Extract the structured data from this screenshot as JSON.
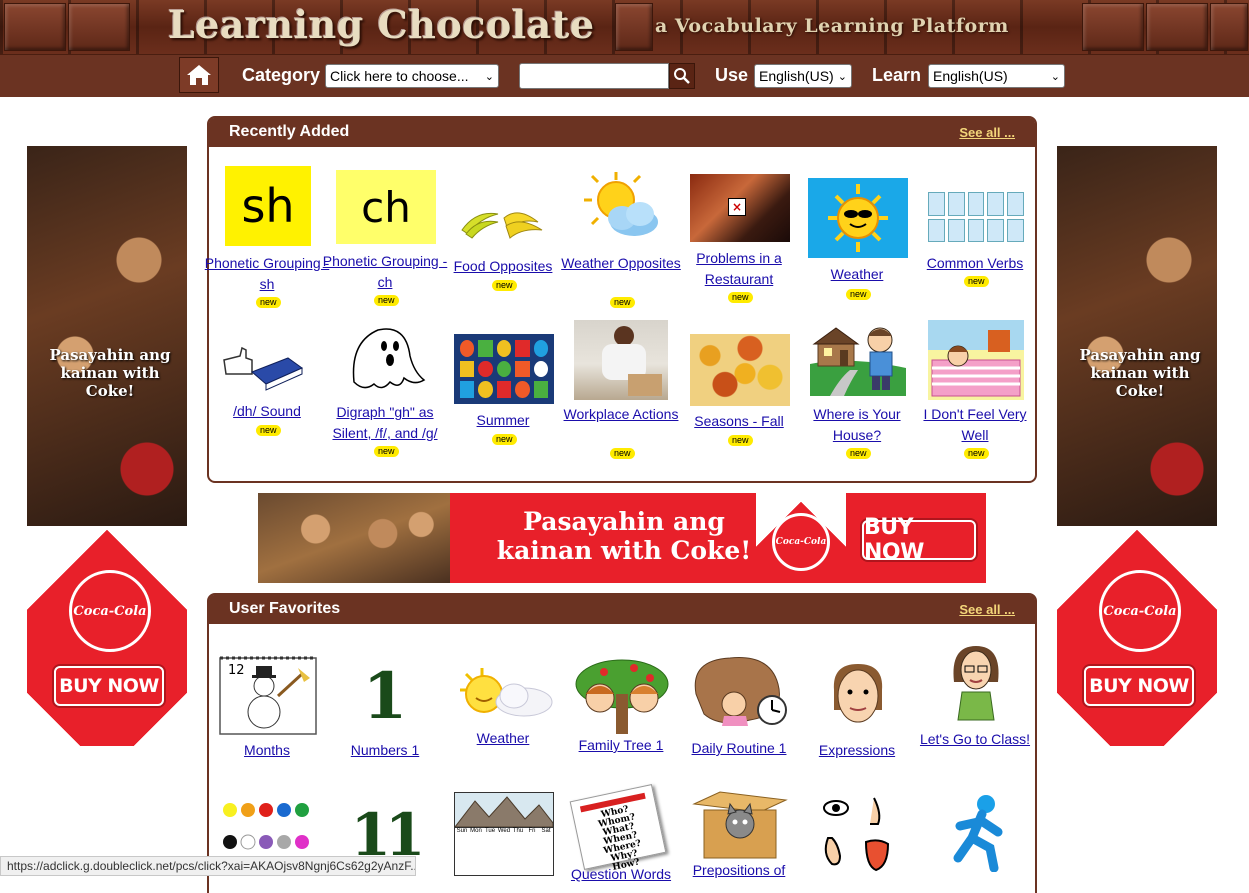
{
  "header": {
    "logo": "Learning Chocolate",
    "tagline": "a Vocabulary Learning Platform"
  },
  "nav": {
    "home_icon": "home-icon",
    "category_label": "Category",
    "category_value": "Click here to choose...",
    "search_value": "",
    "search_icon": "search-icon",
    "use_label": "Use",
    "use_value": "English(US)",
    "learn_label": "Learn",
    "learn_value": "English(US)"
  },
  "recent": {
    "title": "Recently Added",
    "see_all": "See all ...",
    "new_badge": "new",
    "items": [
      {
        "label": "Phonetic Grouping - sh",
        "icon": "sh-card"
      },
      {
        "label": "Phonetic Grouping - ch",
        "icon": "ch-card"
      },
      {
        "label": "Food Opposites",
        "icon": "bananas"
      },
      {
        "label": "Weather Opposites",
        "icon": "sun-cloud"
      },
      {
        "label": "Problems in a Restaurant",
        "icon": "restaurant-photo"
      },
      {
        "label": "Weather",
        "icon": "sun-sunglasses"
      },
      {
        "label": "Common Verbs",
        "icon": "verbs-grid"
      },
      {
        "label": "/dh/ Sound",
        "icon": "thumb-book"
      },
      {
        "label": "Digraph \"gh\" as Silent, /f/, and /g/",
        "icon": "ghost"
      },
      {
        "label": "Summer",
        "icon": "summer-items"
      },
      {
        "label": "Workplace Actions",
        "icon": "worker-photo"
      },
      {
        "label": "Seasons - Fall",
        "icon": "fall-leaves"
      },
      {
        "label": "Where is Your House?",
        "icon": "house-boy"
      },
      {
        "label": "I Don't Feel Very Well",
        "icon": "sick-girl"
      }
    ]
  },
  "favorites": {
    "title": "User Favorites",
    "see_all": "See all ...",
    "items": [
      {
        "label": "Months",
        "icon": "calendar-snowman",
        "number": "12"
      },
      {
        "label": "Numbers 1",
        "icon": "number-one",
        "number": "1"
      },
      {
        "label": "Weather",
        "icon": "sun-cloud-face"
      },
      {
        "label": "Family Tree 1",
        "icon": "family-tree"
      },
      {
        "label": "Daily Routine 1",
        "icon": "routine-clock"
      },
      {
        "label": "Expressions",
        "icon": "face"
      },
      {
        "label": "Let's Go to Class!",
        "icon": "teacher"
      },
      {
        "label": "",
        "icon": "color-dots"
      },
      {
        "label": "",
        "icon": "number-eleven",
        "number": "11"
      },
      {
        "label": "",
        "icon": "mountain-calendar"
      },
      {
        "label": "Question Words",
        "icon": "question-words-paper"
      },
      {
        "label": "Prepositions of",
        "icon": "cat-box"
      },
      {
        "label": "",
        "icon": "senses"
      },
      {
        "label": "",
        "icon": "running-figure"
      }
    ]
  },
  "calendar_mini": {
    "days": [
      "Sun",
      "Mon",
      "Tue",
      "Wed",
      "Thu",
      "Fri",
      "Sat"
    ]
  },
  "question_paper": {
    "lines": [
      "Who?",
      "Whom?",
      "What?",
      "When?",
      "Where?",
      "Why?",
      "How?"
    ]
  },
  "ads": {
    "side_text": "Pasayahin ang kainan with Coke!",
    "brand": "Coca-Cola",
    "buy_now": "BUY NOW",
    "banner_text": "Pasayahin ang kainan with Coke!",
    "banner_buy_now": "BUY NOW"
  },
  "status_bar": "https://adclick.g.doubleclick.net/pcs/click?xai=AKAOjsv8Ngnj6Cs62g2yAnzF..."
}
